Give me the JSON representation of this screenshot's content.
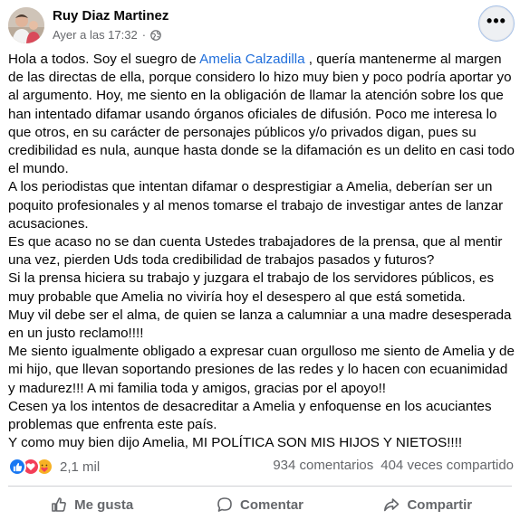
{
  "post": {
    "author": "Ruy Diaz Martinez",
    "timestamp": "Ayer a las 17:32",
    "separator": "·",
    "audience_icon": "globe-icon",
    "more_icon": "ellipsis-icon",
    "more_label": "•••",
    "paragraphs": {
      "p1_before": "Hola a todos. Soy el suegro de ",
      "p1_mention": "Amelia Calzadilla",
      "p1_after": " , quería mantenerme al margen de las directas de ella, porque considero lo hizo muy bien y poco podría aportar yo al argumento. Hoy, me siento en la obligación de llamar la atención sobre los que han intentado difamar  usando órganos oficiales de difusión. Poco me interesa lo que otros, en su carácter de personajes públicos y/o privados digan, pues su credibilidad es nula, aunque hasta donde se la difamación es un delito en casi todo el mundo.",
      "p2": "A los periodistas que intentan difamar o desprestigiar a Amelia, deberían ser un poquito profesionales y al menos tomarse el trabajo de investigar antes de lanzar acusaciones.",
      "p3": "Es que acaso no se dan cuenta Ustedes trabajadores de la prensa, que al mentir una vez, pierden Uds toda credibilidad de trabajos pasados y futuros?",
      "p4": "Si la prensa hiciera su trabajo y juzgara el trabajo de los servidores públicos, es muy probable que Amelia no viviría hoy el desespero al que está sometida.",
      "p5": "Muy vil debe ser el alma, de quien se lanza a calumniar a una madre desesperada en un justo reclamo!!!!",
      "p6": "Me siento igualmente obligado a expresar cuan orgulloso me siento de Amelia y de mi hijo, que llevan soportando presiones de las redes y lo hacen con ecuanimidad y madurez!!! A mi familia toda y amigos, gracias por el apoyo!!",
      "p7": "Cesen ya los intentos de desacreditar a Amelia y enfoquense en los acuciantes problemas que enfrenta este país.",
      "p8": "Y como muy bien dijo Amelia, MI POLÍTICA SON MIS HIJOS Y NIETOS!!!!"
    }
  },
  "stats": {
    "reaction_icons": [
      "like-icon",
      "love-icon",
      "care-icon"
    ],
    "reaction_count": "2,1 mil",
    "comments": "934 comentarios",
    "shares": "404 veces compartido"
  },
  "actions": {
    "like": "Me gusta",
    "comment": "Comentar",
    "share": "Compartir"
  },
  "colors": {
    "text": "#050505",
    "secondary": "#65676b",
    "link": "#216fdb",
    "like": "#1877f2",
    "love": "#f33e58",
    "care": "#f7b125"
  }
}
